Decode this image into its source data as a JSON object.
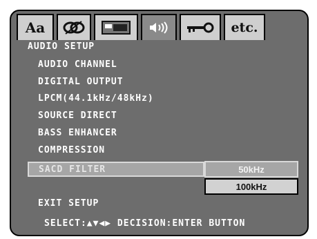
{
  "tabs": [
    {
      "name": "tab-language",
      "label": "Aa"
    },
    {
      "name": "tab-picture",
      "label": ""
    },
    {
      "name": "tab-display",
      "label": ""
    },
    {
      "name": "tab-audio",
      "label": "(()))"
    },
    {
      "name": "tab-lock",
      "label": ""
    },
    {
      "name": "tab-etc",
      "label": "etc."
    }
  ],
  "menu": {
    "title": "AUDIO SETUP",
    "items": [
      "AUDIO CHANNEL",
      "DIGITAL OUTPUT",
      "LPCM(44.1kHz/48kHz)",
      "SOURCE DIRECT",
      "BASS ENHANCER",
      "COMPRESSION"
    ],
    "selected_item": "SACD FILTER",
    "options": [
      "50kHz",
      "100kHz"
    ],
    "exit": "EXIT SETUP"
  },
  "footer": "SELECT:▲▼◀▶ DECISION:ENTER BUTTON",
  "colors": {
    "panel": "#6d6d6d",
    "highlight": "#a6a6a6",
    "text": "#ffffff"
  }
}
